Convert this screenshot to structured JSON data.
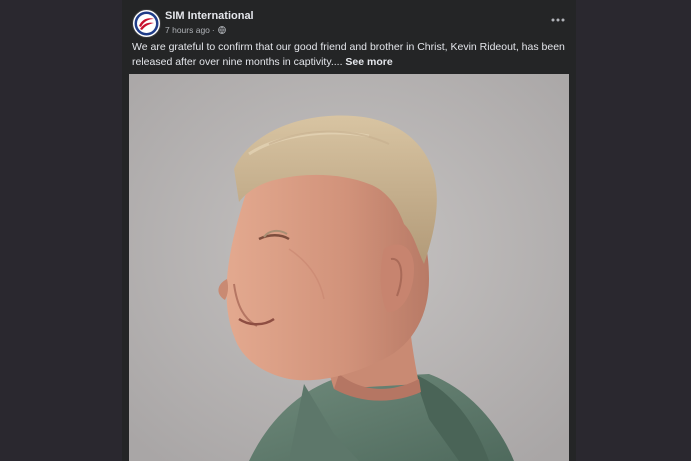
{
  "post": {
    "page_name": "SIM International",
    "timestamp": "7 hours ago",
    "separator": "·",
    "audience_icon": "globe-icon",
    "more_icon": "more-options-icon",
    "avatar_icon": "sim-logo-icon",
    "caption": "We are grateful to confirm that our good friend and brother in Christ, Kevin Rideout, has been released after over nine months in captivity....",
    "see_more": "See more"
  },
  "colors": {
    "page_background": "#2a282f",
    "card_background": "#242526",
    "primary_text": "#e4e6eb",
    "secondary_text": "#b0b3b8",
    "logo_red": "#c8102e",
    "logo_blue": "#1f3c88"
  }
}
